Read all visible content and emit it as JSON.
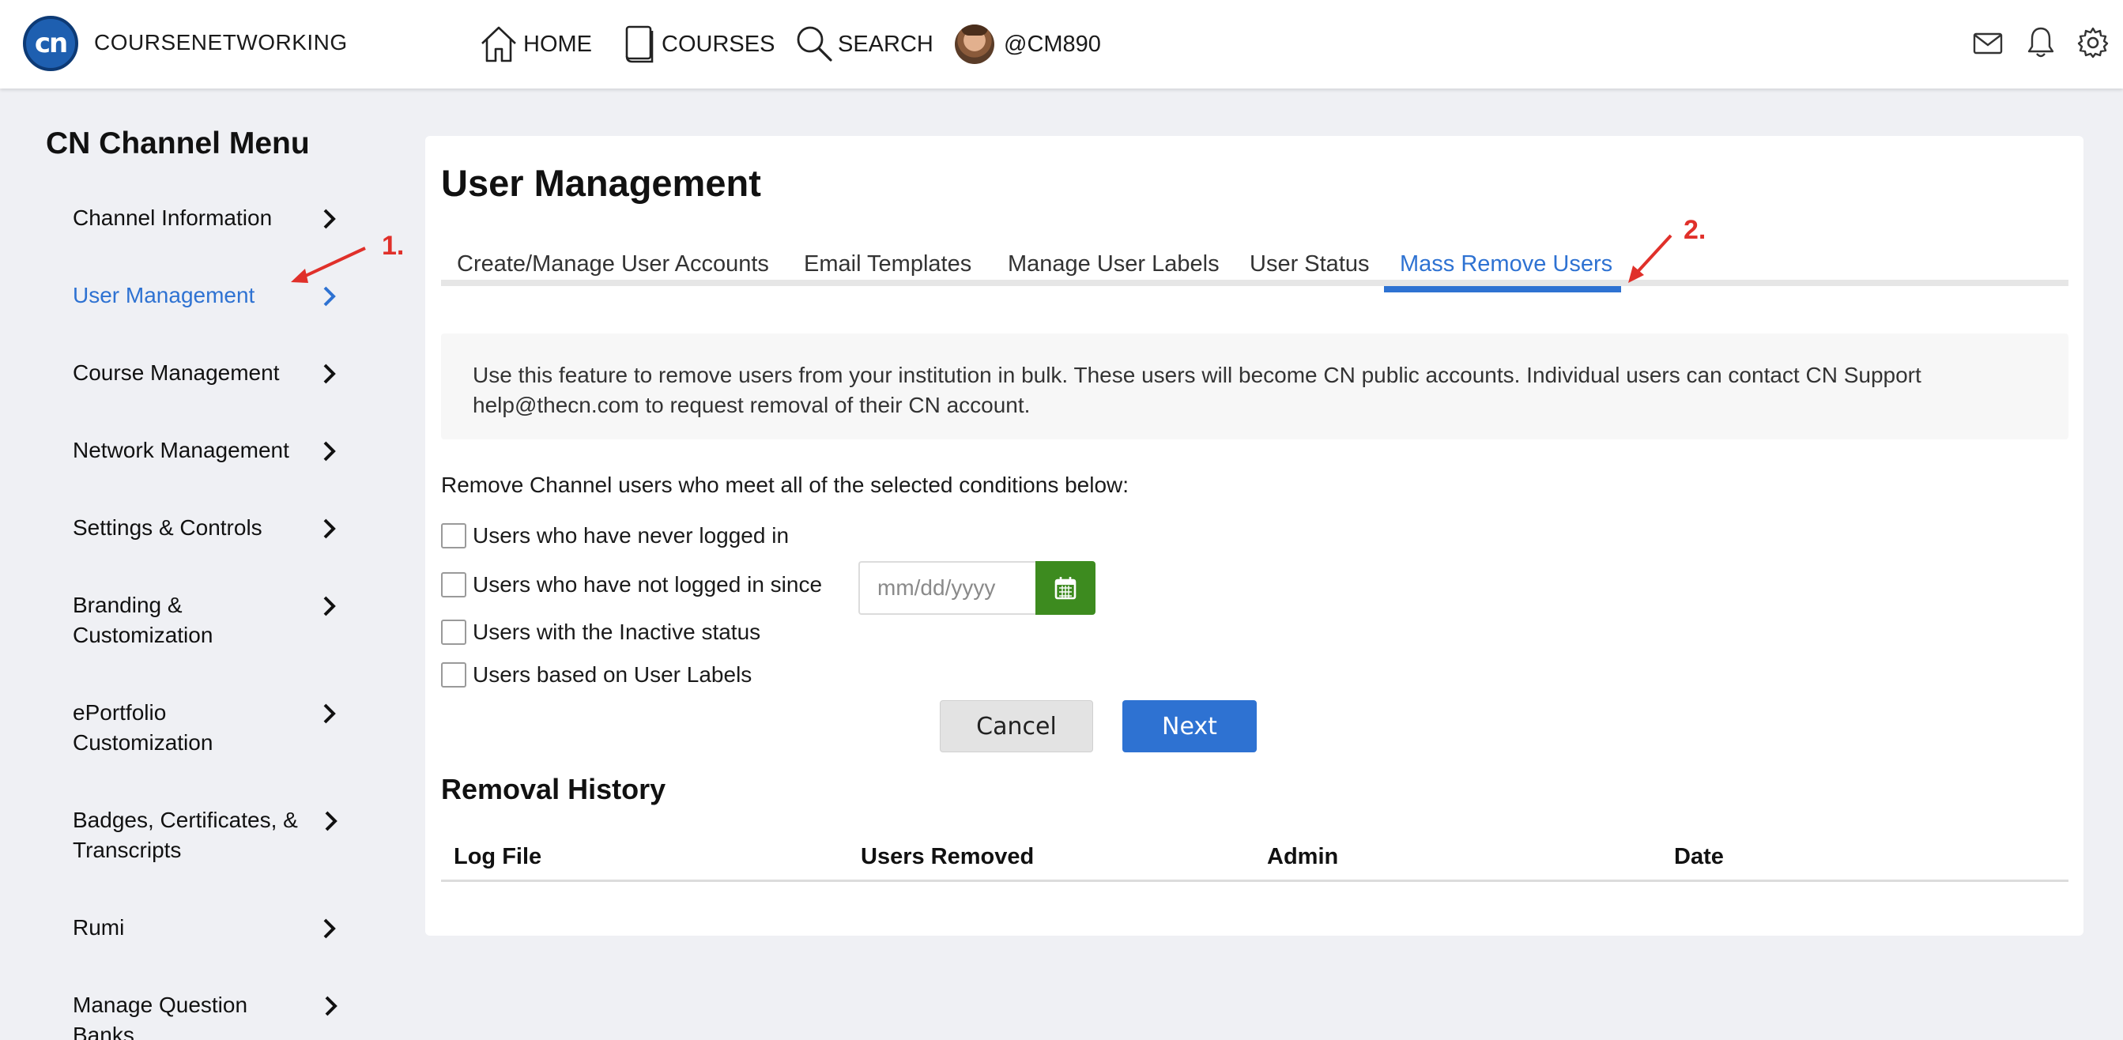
{
  "brand": {
    "name": "COURSENETWORKING",
    "logo_text": "cn"
  },
  "nav": {
    "home": "HOME",
    "courses": "COURSES",
    "search": "SEARCH",
    "user": "@CM890"
  },
  "sidebar": {
    "title": "CN Channel Menu",
    "items": [
      {
        "label": "Channel Information"
      },
      {
        "label": "User Management"
      },
      {
        "label": "Course Management"
      },
      {
        "label": "Network Management"
      },
      {
        "label": "Settings & Controls"
      },
      {
        "label": "Branding & Customization"
      },
      {
        "label": "ePortfolio Customization"
      },
      {
        "label": "Badges, Certificates, & Transcripts"
      },
      {
        "label": "Rumi"
      },
      {
        "label": "Manage Question Banks"
      }
    ]
  },
  "main": {
    "title": "User Management",
    "tabs": [
      {
        "label": "Create/Manage User Accounts"
      },
      {
        "label": "Email Templates"
      },
      {
        "label": "Manage User Labels"
      },
      {
        "label": "User Status"
      },
      {
        "label": "Mass Remove Users"
      }
    ],
    "info": "Use this feature to remove users from your institution in bulk. These users will become CN public accounts. Individual users can contact CN Support help@thecn.com to request removal of their CN account.",
    "conditions_title": "Remove Channel users who meet all of the selected conditions below:",
    "conditions": [
      {
        "label": "Users who have never logged in"
      },
      {
        "label": "Users who have not logged in since"
      },
      {
        "label": "Users with the Inactive status"
      },
      {
        "label": "Users based on User Labels"
      }
    ],
    "date_placeholder": "mm/dd/yyyy",
    "cancel_label": "Cancel",
    "next_label": "Next",
    "history_title": "Removal History",
    "history_columns": [
      "Log File",
      "Users Removed",
      "Admin",
      "Date"
    ]
  },
  "annotations": {
    "one": "1.",
    "two": "2."
  },
  "colors": {
    "accent": "#2e72d2",
    "calendar": "#3d8b1f",
    "annotation": "#e0302a"
  }
}
